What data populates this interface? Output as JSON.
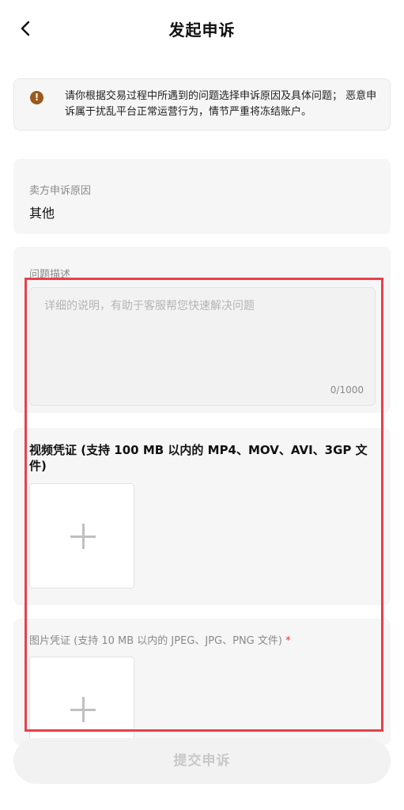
{
  "header": {
    "title": "发起申诉"
  },
  "notice": {
    "icon": "exclamation-icon",
    "text": "请你根据交易过程中所遇到的问题选择申诉原因及具体问题； 恶意申诉属于扰乱平台正常运营行为，情节严重将冻结账户。"
  },
  "reason": {
    "label": "卖方申诉原因",
    "value": "其他"
  },
  "description": {
    "label": "问题描述",
    "placeholder": "详细的说明，有助于客服帮您快速解决问题",
    "count": "0/1000"
  },
  "video": {
    "title": "视频凭证 (支持 100 MB 以内的 MP4、MOV、AVI、3GP 文件)"
  },
  "image": {
    "title": "图片凭证 (支持 10 MB 以内的 JPEG、JPG、PNG 文件)",
    "required_mark": "*"
  },
  "submit": {
    "label": "提交申诉"
  },
  "colors": {
    "highlight": "#e8404a",
    "notice_icon": "#9a5a1e",
    "required": "#e0362f"
  }
}
